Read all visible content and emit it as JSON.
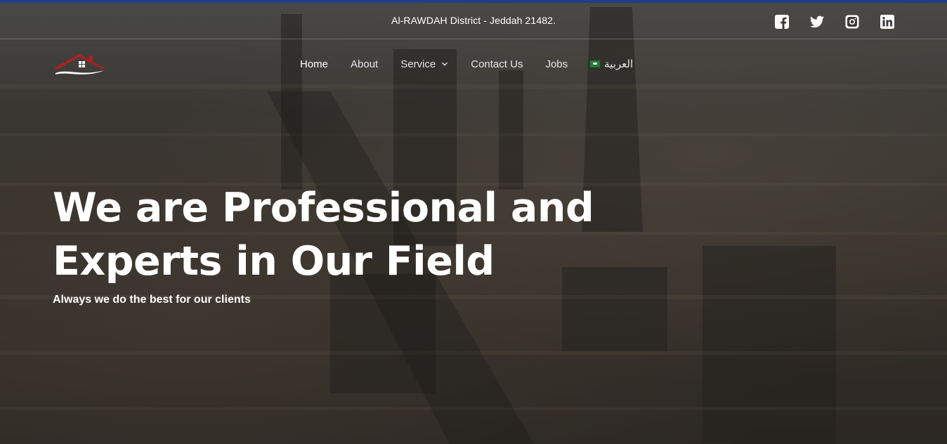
{
  "topbar": {
    "address": "Al-RAWDAH District - Jeddah 21482.",
    "social": [
      "facebook-icon",
      "twitter-icon",
      "instagram-icon",
      "linkedin-icon"
    ]
  },
  "nav": {
    "items": [
      {
        "label": "Home"
      },
      {
        "label": "About"
      },
      {
        "label": "Service"
      },
      {
        "label": "Contact Us"
      },
      {
        "label": "Jobs"
      },
      {
        "label": "العربية"
      }
    ]
  },
  "hero": {
    "headline_line1": "We are Professional and",
    "headline_line2": "Experts in Our Field",
    "tagline": "Always we do the best for our clients"
  },
  "colors": {
    "accent_bar": "#1e3f8a",
    "logo_red": "#b0201e",
    "flag_green": "#1f7a35"
  }
}
